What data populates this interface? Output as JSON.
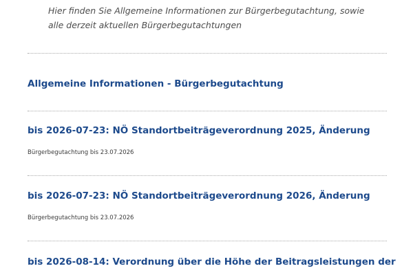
{
  "intro": {
    "line1": "Hier finden Sie Allgemeine Informationen zur Bürgerbegutachtung, sowie",
    "line2": "alle derzeit aktuellen Bürgerbegutachtungen"
  },
  "general_link": "Allgemeine Informationen - Bürgerbegutachtung",
  "entries": [
    {
      "title": "bis 2026-07-23: NÖ Standortbeiträgeverordnung 2025, Änderung",
      "subtitle": "Bürgerbegutachtung bis 23.07.2026"
    },
    {
      "title": "bis 2026-07-23: NÖ Standortbeiträgeverordnung 2026, Änderung",
      "subtitle": "Bürgerbegutachtung bis 23.07.2026"
    },
    {
      "title": "bis 2026-08-14: Verordnung über die Höhe der Beitragsleistungen der",
      "subtitle": ""
    }
  ],
  "colors": {
    "link": "#1d4a8c",
    "intro_text": "#4d4d4d",
    "divider": "#a8a8a8"
  }
}
